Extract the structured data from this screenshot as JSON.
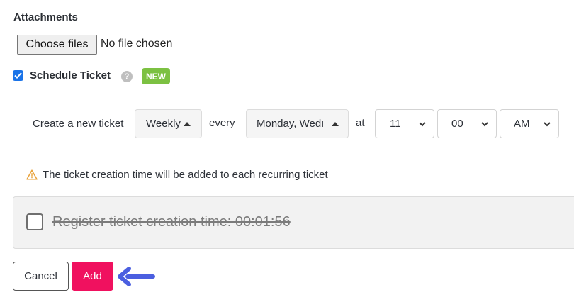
{
  "attachments": {
    "label": "Attachments",
    "choose_files_label": "Choose files",
    "no_file_text": "No file chosen"
  },
  "schedule": {
    "checkbox_checked": true,
    "label": "Schedule Ticket",
    "help_icon": "question-circle-icon",
    "badge": "NEW",
    "create_label": "Create a new ticket",
    "frequency_value": "Weekly",
    "every_label": "every",
    "days_value": "Monday, Wedı",
    "at_label": "at",
    "hour_value": "11",
    "minute_value": "00",
    "ampm_value": "AM"
  },
  "notice": {
    "icon": "warning-triangle-icon",
    "text": "The ticket creation time will be added to each recurring ticket"
  },
  "register": {
    "checked": false,
    "text": "Register ticket creation time: 00:01:56"
  },
  "actions": {
    "cancel_label": "Cancel",
    "add_label": "Add"
  },
  "colors": {
    "add_button": "#f0115f",
    "new_badge": "#7cc142",
    "checkbox": "#1a73e8",
    "arrow": "#4b5fe0",
    "warning": "#e8a23a"
  }
}
